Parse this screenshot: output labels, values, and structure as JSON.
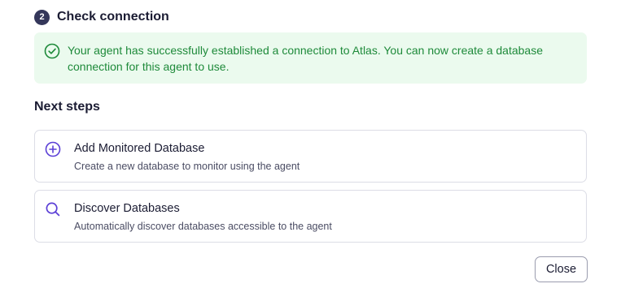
{
  "step": {
    "number": "2",
    "title": "Check connection"
  },
  "success": {
    "icon": "check-circle-icon",
    "message": "Your agent has successfully established a connection to Atlas. You can now create a database connection for this agent to use.",
    "color": "#1e8a3a",
    "background": "#ebfaee"
  },
  "next_steps": {
    "title": "Next steps",
    "items": [
      {
        "icon": "plus-circle-icon",
        "title": "Add Monitored Database",
        "description": "Create a new database to monitor using the agent"
      },
      {
        "icon": "search-icon",
        "title": "Discover Databases",
        "description": "Automatically discover databases accessible to the agent"
      }
    ]
  },
  "footer": {
    "close_label": "Close"
  },
  "colors": {
    "accent": "#5b3fd6",
    "step_badge": "#34375a",
    "border": "#dcdde6"
  }
}
